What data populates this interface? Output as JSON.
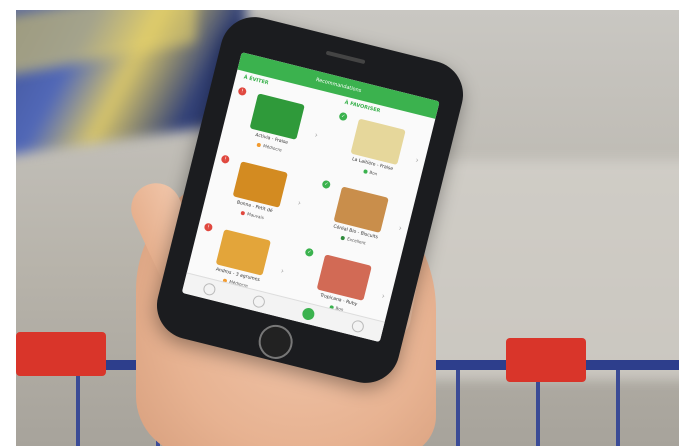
{
  "app": {
    "title": "Recommandations",
    "left_column": "À ÉVITER",
    "right_column": "À FAVORISER",
    "colors": {
      "accent": "#3bb24e",
      "avoid": "#e0483f",
      "favor": "#3bb24e",
      "warn": "#f29a2e"
    }
  },
  "products": [
    {
      "name": "Activia - Fraise",
      "grade": "Médiocre",
      "grade_color": "#f29a2e",
      "badge": "!",
      "badge_color": "#e0483f",
      "img_color": "#2f9a3a"
    },
    {
      "name": "La Laitière - Fraise",
      "grade": "Bon",
      "grade_color": "#3bb24e",
      "badge": "✓",
      "badge_color": "#3bb24e",
      "img_color": "#e6d79b"
    },
    {
      "name": "Bonne - Petit dé",
      "grade": "Mauvais",
      "grade_color": "#e0483f",
      "badge": "!",
      "badge_color": "#e0483f",
      "img_color": "#d38b21"
    },
    {
      "name": "Céréal Bio - Biscuits",
      "grade": "Excellent",
      "grade_color": "#2e8b3b",
      "badge": "✓",
      "badge_color": "#3bb24e",
      "img_color": "#c98e4b"
    },
    {
      "name": "Andros - 3 agrumes",
      "grade": "Médiocre",
      "grade_color": "#f29a2e",
      "badge": "!",
      "badge_color": "#e0483f",
      "img_color": "#e3a53a"
    },
    {
      "name": "Tropicana - Ruby",
      "grade": "Bon",
      "grade_color": "#3bb24e",
      "badge": "✓",
      "badge_color": "#3bb24e",
      "img_color": "#d26a55"
    }
  ]
}
